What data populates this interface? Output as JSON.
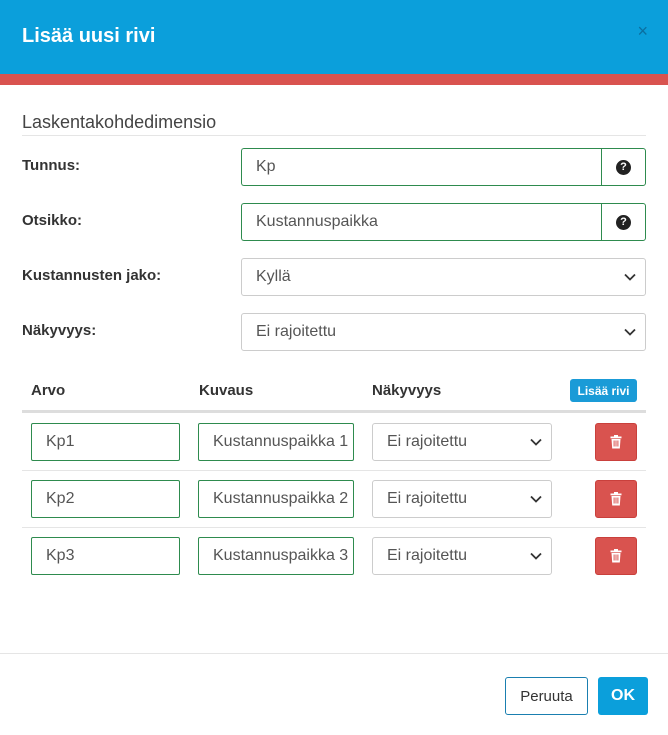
{
  "dialog": {
    "title": "Lisää uusi rivi",
    "close_symbol": "×"
  },
  "section": {
    "title": "Laskentakohdedimensio"
  },
  "form": {
    "tunnus_label": "Tunnus:",
    "tunnus_value": "Kp",
    "otsikko_label": "Otsikko:",
    "otsikko_value": "Kustannuspaikka",
    "jako_label": "Kustannusten jako:",
    "jako_value": "Kyllä",
    "nakyvyys_label": "Näkyvyys:",
    "nakyvyys_value": "Ei rajoitettu",
    "help_icon": "question-circle"
  },
  "table": {
    "headers": {
      "arvo": "Arvo",
      "kuvaus": "Kuvaus",
      "nakyvyys": "Näkyvyys"
    },
    "add_row_label": "Lisää rivi",
    "rows": [
      {
        "arvo": "Kp1",
        "kuvaus": "Kustannuspaikka 1",
        "nakyvyys": "Ei rajoitettu"
      },
      {
        "arvo": "Kp2",
        "kuvaus": "Kustannuspaikka 2",
        "nakyvyys": "Ei rajoitettu"
      },
      {
        "arvo": "Kp3",
        "kuvaus": "Kustannuspaikka 3",
        "nakyvyys": "Ei rajoitettu"
      }
    ]
  },
  "footer": {
    "cancel_label": "Peruuta",
    "ok_label": "OK"
  },
  "colors": {
    "header_bg": "#0b9fdb",
    "accent_stripe": "#d9534f",
    "input_border": "#2e8b4e",
    "delete_button": "#d9534f"
  }
}
